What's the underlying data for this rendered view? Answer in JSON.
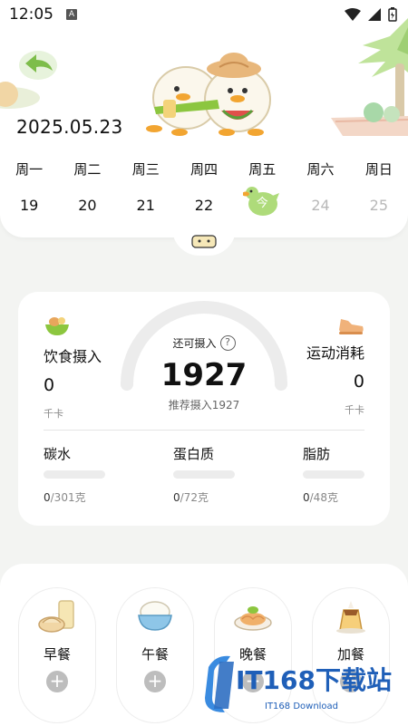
{
  "status_bar": {
    "time": "12:05",
    "notification_letter": "A"
  },
  "header": {
    "date": "2025.05.23",
    "week": [
      {
        "day": "周一",
        "date": "19",
        "state": "past"
      },
      {
        "day": "周二",
        "date": "20",
        "state": "past"
      },
      {
        "day": "周三",
        "date": "21",
        "state": "past"
      },
      {
        "day": "周四",
        "date": "22",
        "state": "past"
      },
      {
        "day": "周五",
        "date": "今",
        "state": "today"
      },
      {
        "day": "周六",
        "date": "24",
        "state": "future"
      },
      {
        "day": "周日",
        "date": "25",
        "state": "future"
      }
    ]
  },
  "nutrition": {
    "intake_label": "饮食摄入",
    "intake_value": "0",
    "intake_unit": "千卡",
    "remaining_label": "还可摄入",
    "remaining_value": "1927",
    "recommend_text": "推荐摄入1927",
    "exercise_label": "运动消耗",
    "exercise_value": "0",
    "exercise_unit": "千卡",
    "macros": [
      {
        "name": "碳水",
        "current": "0",
        "target": "/301克"
      },
      {
        "name": "蛋白质",
        "current": "0",
        "target": "/72克"
      },
      {
        "name": "脂肪",
        "current": "0",
        "target": "/48克"
      }
    ]
  },
  "meals": [
    {
      "name": "早餐",
      "icon": "breakfast-icon"
    },
    {
      "name": "午餐",
      "icon": "rice-bowl-icon"
    },
    {
      "name": "晚餐",
      "icon": "noodles-icon"
    },
    {
      "name": "加餐",
      "icon": "pudding-icon"
    }
  ],
  "watermark": {
    "brand": "IT168下载站",
    "sub": "IT168 Download"
  },
  "colors": {
    "accent_green": "#8cc63f",
    "tab_active": "#aedb7a",
    "bar_bg": "#ececec"
  }
}
